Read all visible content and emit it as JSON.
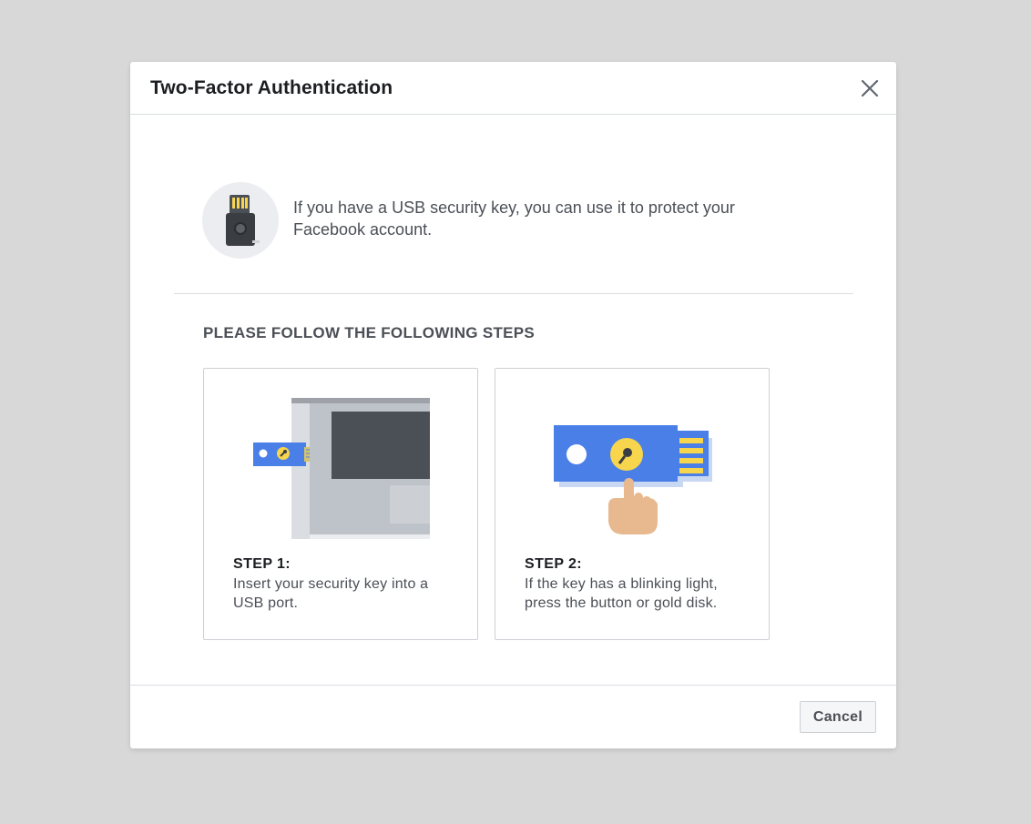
{
  "dialog": {
    "title": "Two-Factor Authentication",
    "close_icon": "close-icon"
  },
  "intro": {
    "icon": "usb-key-icon",
    "text": "If you have a USB security key, you can use it to protect your Facebook account."
  },
  "steps_heading": "PLEASE FOLLOW THE FOLLOWING STEPS",
  "steps": [
    {
      "title": "STEP 1:",
      "description": "Insert your security key into a USB port.",
      "illustration": "laptop-usb-insert-illustration"
    },
    {
      "title": "STEP 2:",
      "description": "If the key has a blinking light, press the button or gold disk.",
      "illustration": "finger-press-key-illustration"
    }
  ],
  "footer": {
    "cancel_label": "Cancel"
  },
  "colors": {
    "overlay": "#d8d8d8",
    "key_blue": "#4a7fe7",
    "key_gold": "#f7d54d",
    "text_dark": "#1c1e21",
    "text_muted": "#4b4f56"
  }
}
